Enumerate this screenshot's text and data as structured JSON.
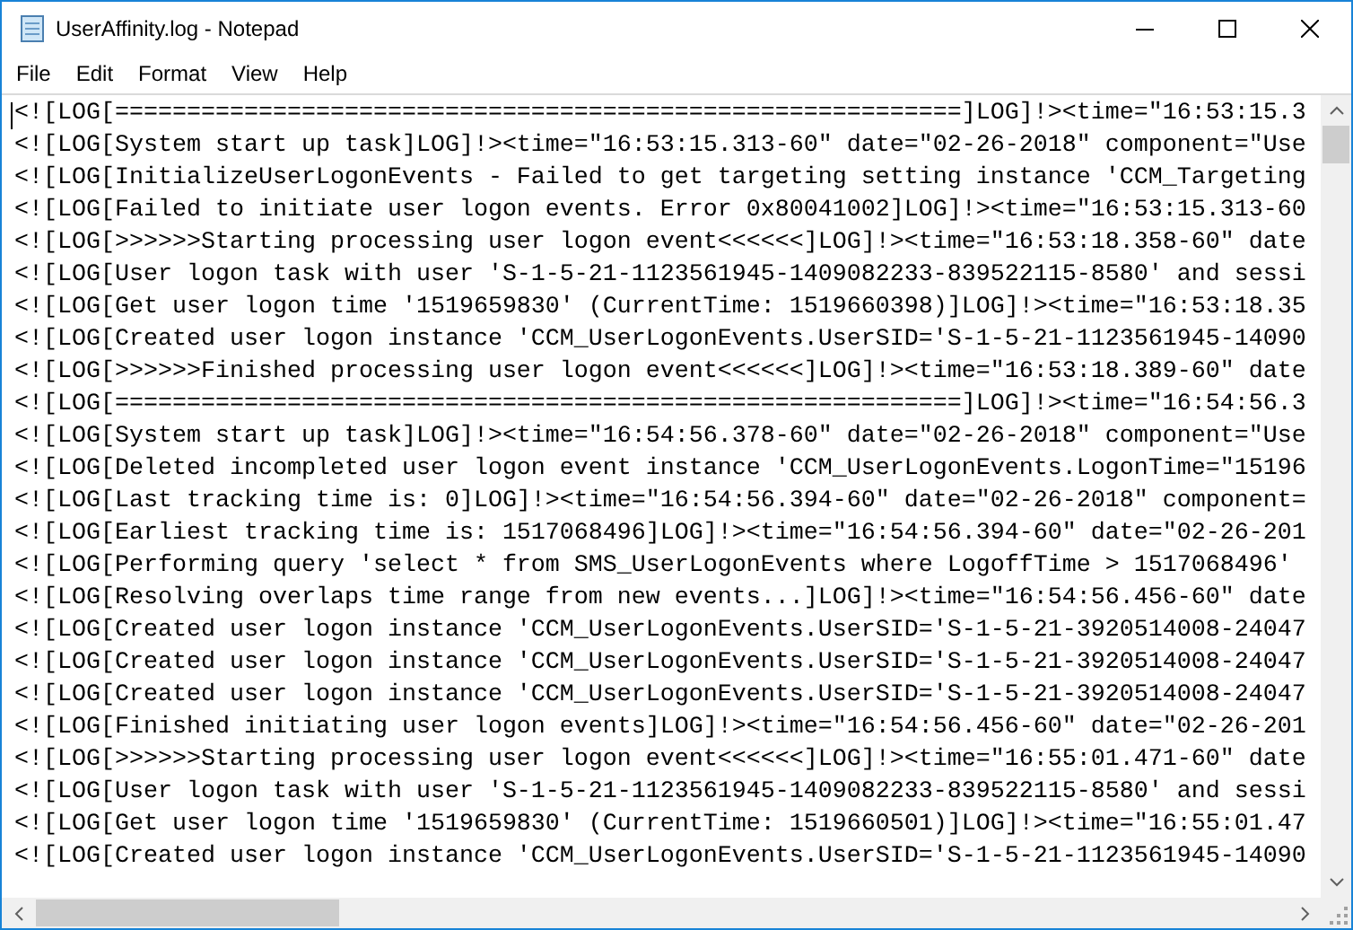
{
  "window": {
    "title": "UserAffinity.log - Notepad"
  },
  "menu": [
    "File",
    "Edit",
    "Format",
    "View",
    "Help"
  ],
  "lines": [
    "<![LOG[===========================================================]LOG]!><time=\"16:53:15.3",
    "<![LOG[System start up task]LOG]!><time=\"16:53:15.313-60\" date=\"02-26-2018\" component=\"Use",
    "<![LOG[InitializeUserLogonEvents - Failed to get targeting setting instance 'CCM_Targeting",
    "<![LOG[Failed to initiate user logon events. Error 0x80041002]LOG]!><time=\"16:53:15.313-60",
    "<![LOG[>>>>>>Starting processing user logon event<<<<<<]LOG]!><time=\"16:53:18.358-60\" date",
    "<![LOG[User logon task with user 'S-1-5-21-1123561945-1409082233-839522115-8580' and sessi",
    "<![LOG[Get user logon time '1519659830' (CurrentTime: 1519660398)]LOG]!><time=\"16:53:18.35",
    "<![LOG[Created user logon instance 'CCM_UserLogonEvents.UserSID='S-1-5-21-1123561945-14090",
    "<![LOG[>>>>>>Finished processing user logon event<<<<<<]LOG]!><time=\"16:53:18.389-60\" date",
    "<![LOG[===========================================================]LOG]!><time=\"16:54:56.3",
    "<![LOG[System start up task]LOG]!><time=\"16:54:56.378-60\" date=\"02-26-2018\" component=\"Use",
    "<![LOG[Deleted incompleted user logon event instance 'CCM_UserLogonEvents.LogonTime=\"15196",
    "<![LOG[Last tracking time is: 0]LOG]!><time=\"16:54:56.394-60\" date=\"02-26-2018\" component=",
    "<![LOG[Earliest tracking time is: 1517068496]LOG]!><time=\"16:54:56.394-60\" date=\"02-26-201",
    "<![LOG[Performing query 'select * from SMS_UserLogonEvents where LogoffTime > 1517068496'",
    "<![LOG[Resolving overlaps time range from new events...]LOG]!><time=\"16:54:56.456-60\" date",
    "<![LOG[Created user logon instance 'CCM_UserLogonEvents.UserSID='S-1-5-21-3920514008-24047",
    "<![LOG[Created user logon instance 'CCM_UserLogonEvents.UserSID='S-1-5-21-3920514008-24047",
    "<![LOG[Created user logon instance 'CCM_UserLogonEvents.UserSID='S-1-5-21-3920514008-24047",
    "<![LOG[Finished initiating user logon events]LOG]!><time=\"16:54:56.456-60\" date=\"02-26-201",
    "<![LOG[>>>>>>Starting processing user logon event<<<<<<]LOG]!><time=\"16:55:01.471-60\" date",
    "<![LOG[User logon task with user 'S-1-5-21-1123561945-1409082233-839522115-8580' and sessi",
    "<![LOG[Get user logon time '1519659830' (CurrentTime: 1519660501)]LOG]!><time=\"16:55:01.47",
    "<![LOG[Created user logon instance 'CCM_UserLogonEvents.UserSID='S-1-5-21-1123561945-14090"
  ]
}
